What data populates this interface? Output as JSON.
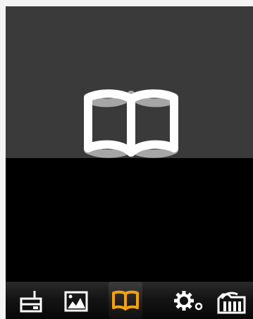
{
  "screen": {
    "upper_color": "#3a3a3a",
    "lower_color": "#000000"
  },
  "hero": {
    "icon": "open-book-icon",
    "color": "#ffffff"
  },
  "menu": {
    "selected_index": 2,
    "accent_color": "#f2a20c",
    "icon_color": "#ffffff",
    "items": [
      {
        "icon": "radio-icon"
      },
      {
        "icon": "photo-icon"
      },
      {
        "icon": "book-icon"
      },
      {
        "icon": "settings-icon"
      },
      {
        "icon": "folder-icon"
      }
    ]
  }
}
